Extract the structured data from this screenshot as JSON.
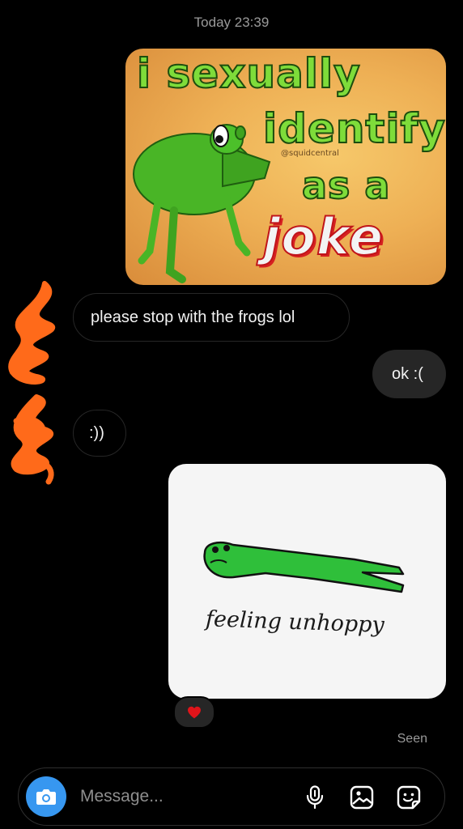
{
  "header": {
    "timestamp": "Today 23:39"
  },
  "messages": {
    "meme": {
      "line1": "i sexually",
      "line2": "identify",
      "line3": "as a",
      "line4": "joke",
      "handle": "@squidcentral"
    },
    "incoming_1": "please stop with the frogs lol",
    "outgoing_1": "ok :(",
    "incoming_2": ":))",
    "sticker": {
      "caption": "feeling unhoppy"
    },
    "reaction_icon": "heart-icon",
    "status": "Seen"
  },
  "composer": {
    "placeholder": "Message...",
    "icons": [
      "camera-icon",
      "microphone-icon",
      "gallery-icon",
      "sticker-icon"
    ],
    "accent_color": "#3797f0"
  },
  "colors": {
    "background": "#000000",
    "outgoing_bubble": "#262626",
    "heart": "#e0141a",
    "scribble": "#ff6a1a"
  }
}
